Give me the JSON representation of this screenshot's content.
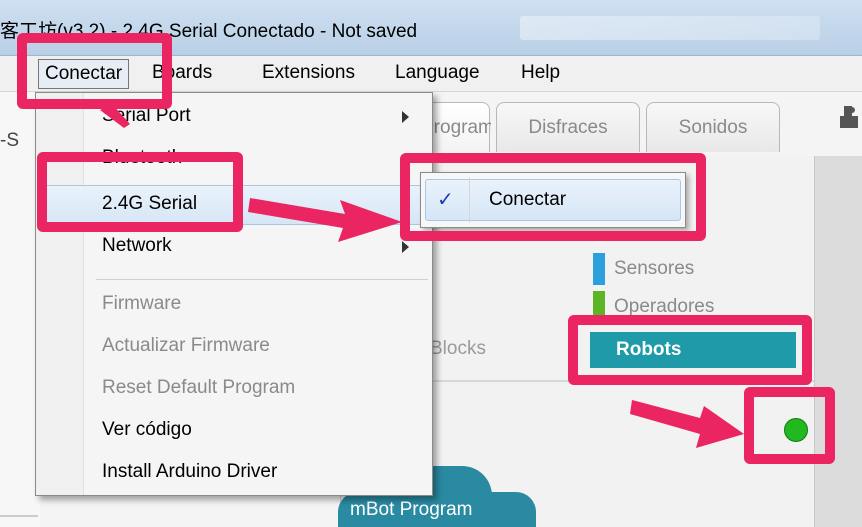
{
  "window": {
    "title": "客工坊(v3.2) - 2.4G Serial Conectado - Not saved"
  },
  "menubar": {
    "items": [
      "Conectar",
      "Boards",
      "Extensions",
      "Language",
      "Help"
    ]
  },
  "dropdown": {
    "items": [
      {
        "label": "Serial Port",
        "submenu": true,
        "disabled": false
      },
      {
        "label": "Bluetooth",
        "submenu": true,
        "disabled": false
      },
      {
        "label": "2.4G Serial",
        "submenu": true,
        "disabled": false,
        "highlighted": true
      },
      {
        "label": "Network",
        "submenu": true,
        "disabled": false
      },
      {
        "label": "Firmware",
        "submenu": false,
        "disabled": true
      },
      {
        "label": "Actualizar Firmware",
        "submenu": false,
        "disabled": true
      },
      {
        "label": "Reset Default Program",
        "submenu": false,
        "disabled": true
      },
      {
        "label": "Ver código",
        "submenu": false,
        "disabled": false
      },
      {
        "label": "Install Arduino Driver",
        "submenu": false,
        "disabled": false
      }
    ]
  },
  "submenu": {
    "check": "✓",
    "label": "Conectar"
  },
  "tabs": [
    "Programas",
    "Disfraces",
    "Sonidos"
  ],
  "left": {
    "label": "-S"
  },
  "categories": {
    "sensores": "Sensores",
    "operadores": "Operadores",
    "robots": "Robots",
    "blocks": "Blocks"
  },
  "script": {
    "block_label": "mBot Program"
  },
  "colors": {
    "annotation": "#ea2561",
    "robots": "#1e9aa8",
    "status_connected": "#22b820",
    "sensores_bar": "#2ba0dc",
    "operadores_bar": "#5cb525"
  },
  "icons": {
    "status": "connected-dot-icon",
    "puzzle": "puzzle-icon",
    "check": "check-icon",
    "submenu_arrow": "chevron-right-icon"
  }
}
